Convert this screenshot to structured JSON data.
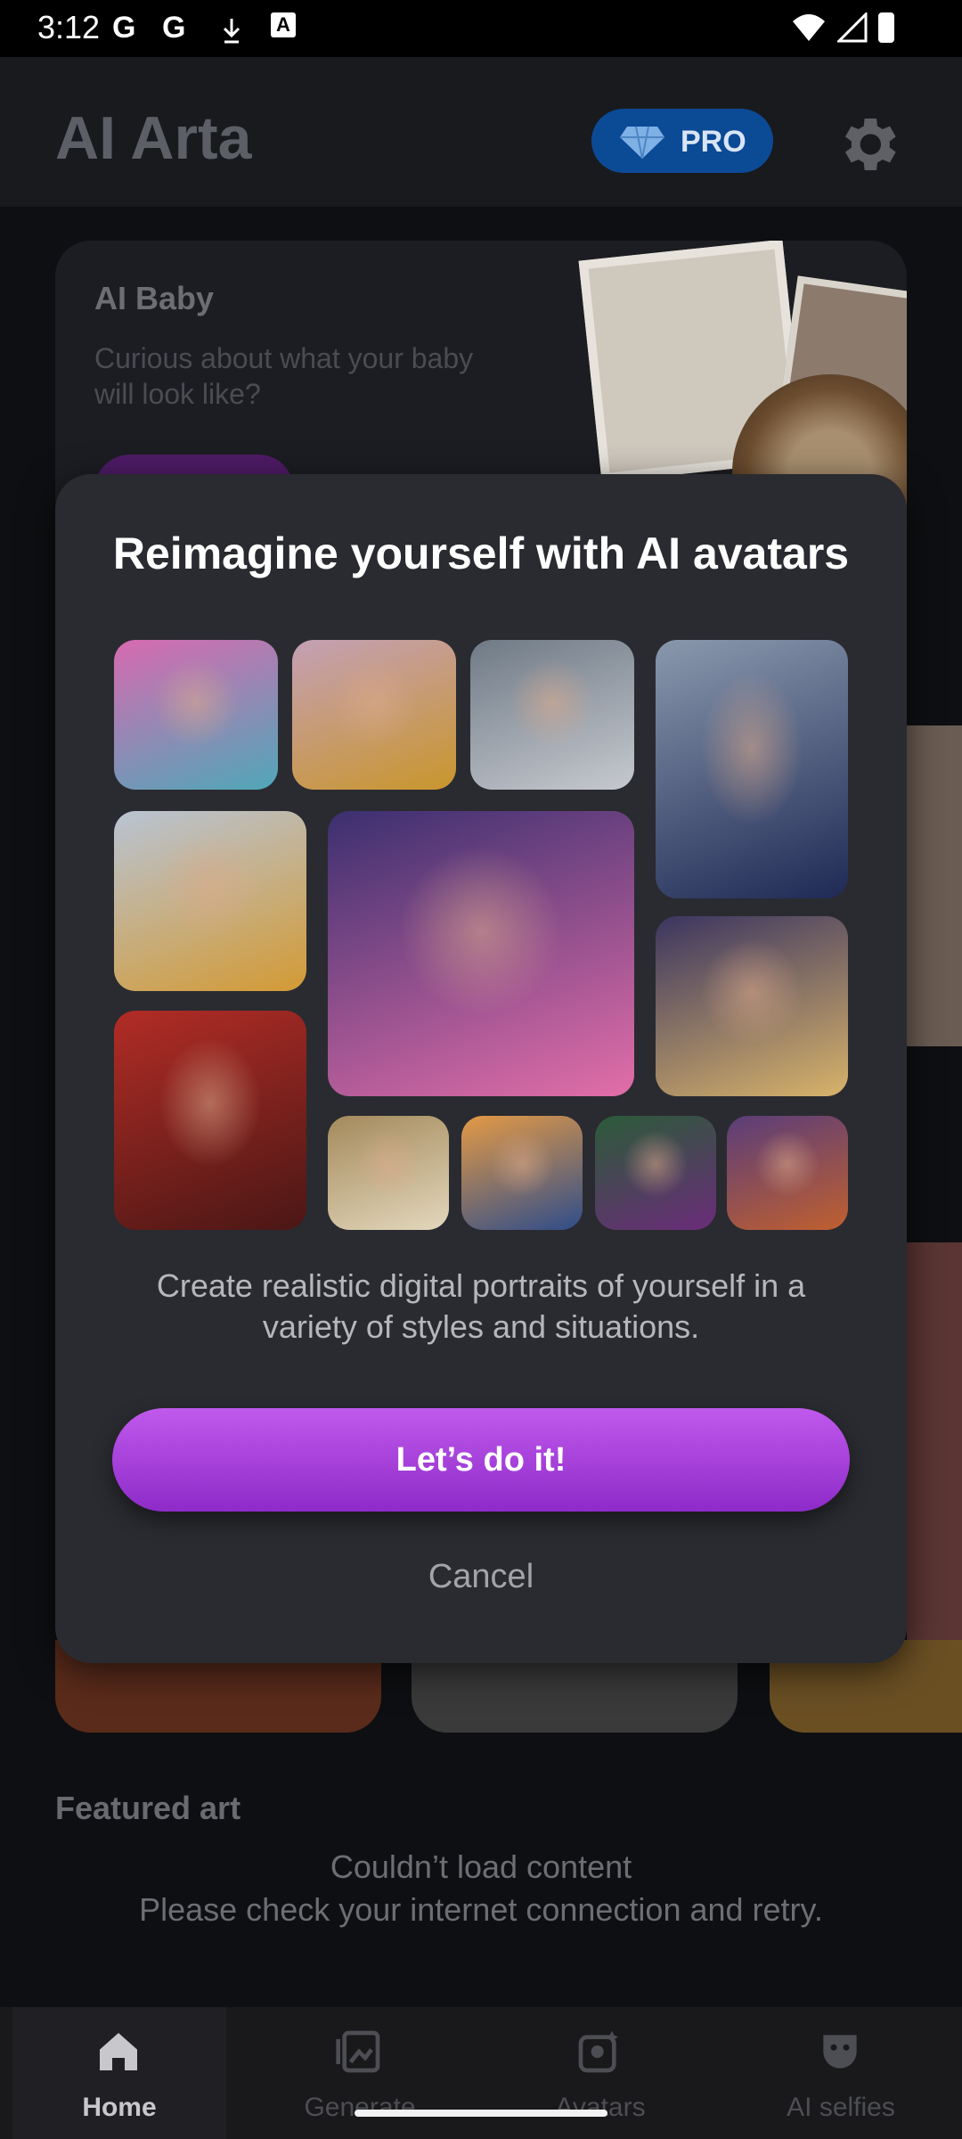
{
  "status_bar": {
    "time": "3:12",
    "notif_icons": [
      "G",
      "G",
      "download-icon",
      "A"
    ]
  },
  "header": {
    "app_title": "AI Arta",
    "pro_label": "PRO"
  },
  "ai_baby_card": {
    "title": "AI Baby",
    "subtitle": "Curious about what your baby will look like?"
  },
  "modal": {
    "title": "Reimagine yourself with AI avatars",
    "description": "Create realistic digital portraits of yourself in a variety of styles and situations.",
    "primary_button": "Let’s do it!",
    "cancel_button": "Cancel",
    "avatar_tiles": [
      {
        "name": "avatar-man-teddy-bear",
        "color_top": "#d86ab0",
        "color_bottom": "#4fa7b8"
      },
      {
        "name": "avatar-woman-yellow-jacket",
        "color_top": "#c4a0b6",
        "color_bottom": "#c9962c"
      },
      {
        "name": "avatar-astronaut",
        "color_top": "#6f7a86",
        "color_bottom": "#c6c9cf"
      },
      {
        "name": "avatar-football-player",
        "color_top": "#8a98ad",
        "color_bottom": "#1f2a55"
      },
      {
        "name": "avatar-woman-yellow-beanie",
        "color_top": "#b9c4d4",
        "color_bottom": "#d39a34"
      },
      {
        "name": "avatar-pink-hair-woman",
        "color_top": "#3b2f6f",
        "color_bottom": "#e26ea9"
      },
      {
        "name": "avatar-blonde-woman",
        "color_top": "#3b3560",
        "color_bottom": "#d8b36a"
      },
      {
        "name": "avatar-white-haired-warrior",
        "color_top": "#b22c26",
        "color_bottom": "#4a1715"
      },
      {
        "name": "avatar-man-top-hat",
        "color_top": "#a48a5c",
        "color_bottom": "#e3d7bc"
      },
      {
        "name": "avatar-anime-captain",
        "color_top": "#e49a45",
        "color_bottom": "#2f4d8a"
      },
      {
        "name": "avatar-sorceress",
        "color_top": "#2b5b38",
        "color_bottom": "#6b2c7a"
      },
      {
        "name": "avatar-mad-hatter",
        "color_top": "#5a3d7a",
        "color_bottom": "#c0602f"
      }
    ]
  },
  "featured": {
    "title": "Featured art",
    "error_title": "Couldn’t load content",
    "error_message": "Please check your internet connection and retry."
  },
  "bottom_nav": {
    "items": [
      {
        "label": "Home",
        "active": true
      },
      {
        "label": "Generate",
        "active": false
      },
      {
        "label": "Avatars",
        "active": false
      },
      {
        "label": "AI selfies",
        "active": false
      }
    ]
  },
  "colors": {
    "accent": "#a93fe0",
    "pro_badge": "#0b4a95",
    "modal_bg": "#2a2b30"
  }
}
